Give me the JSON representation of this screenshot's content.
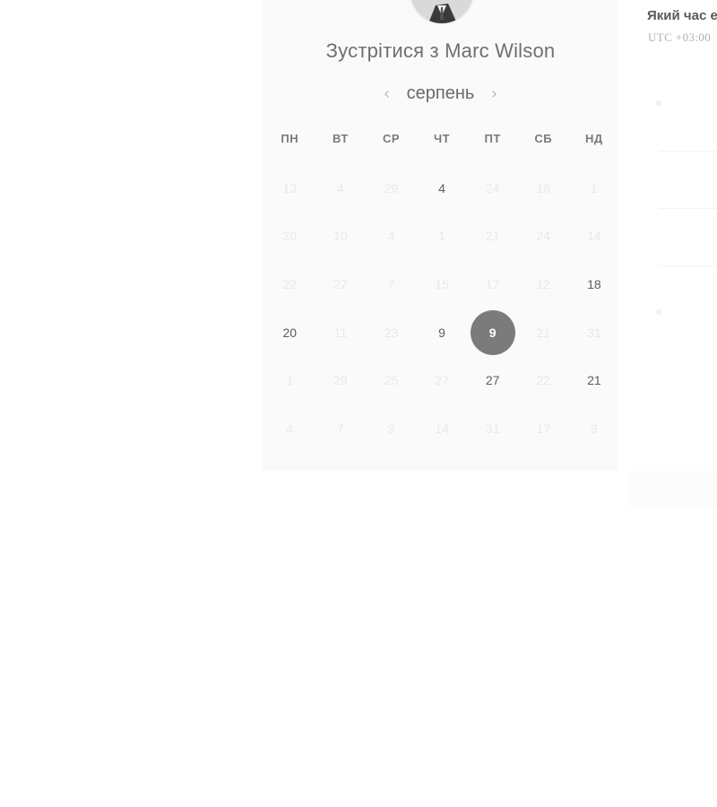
{
  "header": {
    "title": "Зустрітися з Marc Wilson"
  },
  "calendar": {
    "month": "серпень",
    "prev_icon": "chevron-left-icon",
    "next_icon": "chevron-right-icon",
    "weekdays": [
      "ПН",
      "ВТ",
      "СР",
      "ЧТ",
      "ПТ",
      "СБ",
      "НД"
    ],
    "weeks": [
      [
        "13",
        "4",
        "29",
        "4",
        "24",
        "16",
        "1"
      ],
      [
        "20",
        "10",
        "4",
        "1",
        "21",
        "24",
        "14"
      ],
      [
        "22",
        "27",
        "7",
        "15",
        "17",
        "12",
        "18"
      ],
      [
        "20",
        "11",
        "23",
        "9",
        "9",
        "21",
        "31"
      ],
      [
        "1",
        "29",
        "25",
        "27",
        "27",
        "22",
        "21"
      ],
      [
        "4",
        "7",
        "3",
        "14",
        "31",
        "17",
        "9"
      ]
    ],
    "available": [
      "0-3",
      "2-6",
      "3-0",
      "3-3",
      "4-4",
      "4-6"
    ],
    "selected": "3-4",
    "selected_color": "#7b7b7b"
  },
  "side": {
    "question": "Який час е",
    "timezone": "UTC +03:00"
  }
}
